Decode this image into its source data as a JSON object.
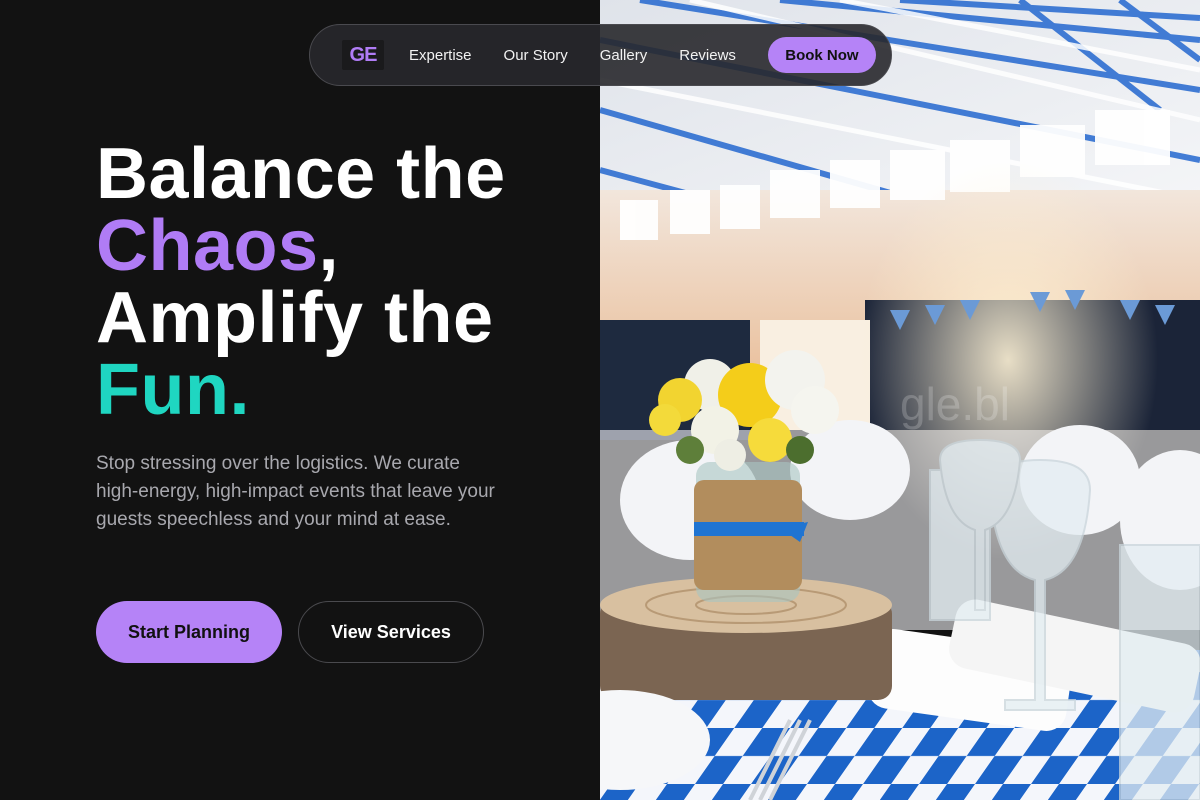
{
  "nav": {
    "logo": "GE",
    "links": [
      "Expertise",
      "Our Story",
      "Gallery",
      "Reviews"
    ],
    "cta": "Book Now"
  },
  "hero": {
    "line1": "Balance the",
    "line2_accent": "Chaos",
    "line2_rest": ",",
    "line3": "Amplify the",
    "line4_accent": "Fun.",
    "subtitle": "Stop stressing over the logistics. We curate high-energy, high-impact events that leave your guests speechless and your mind at ease.",
    "primary_button": "Start Planning",
    "secondary_button": "View Services"
  },
  "photo": {
    "subject": "banquet hall table setting with flower centerpiece",
    "watermark": "gle.bl"
  },
  "colors": {
    "background": "#121212",
    "accent_purple": "#b07cf5",
    "accent_teal": "#1fd6c1",
    "button_purple": "#b583f7"
  }
}
